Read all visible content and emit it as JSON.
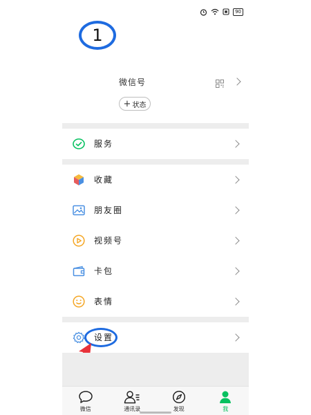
{
  "status_bar": {
    "battery": "90",
    "icons": [
      "alarm-icon",
      "wifi-icon",
      "sim-icon",
      "battery-icon"
    ]
  },
  "profile": {
    "annotation_number": "1",
    "wechat_id_label": "微信号",
    "status_button": "状态"
  },
  "menu": {
    "services": "服务",
    "favorites": "收藏",
    "moments": "朋友圈",
    "channels": "视频号",
    "cards": "卡包",
    "stickers": "表情",
    "settings": "设置"
  },
  "tabs": [
    {
      "label": "微信",
      "icon": "chat-icon"
    },
    {
      "label": "通讯录",
      "icon": "contacts-icon"
    },
    {
      "label": "发现",
      "icon": "discover-icon"
    },
    {
      "label": "我",
      "icon": "me-icon"
    }
  ],
  "colors": {
    "accent_green": "#07c160",
    "annotation_blue": "#1e6be0",
    "annotation_red": "#e8323a",
    "section_gap": "#ededed"
  }
}
